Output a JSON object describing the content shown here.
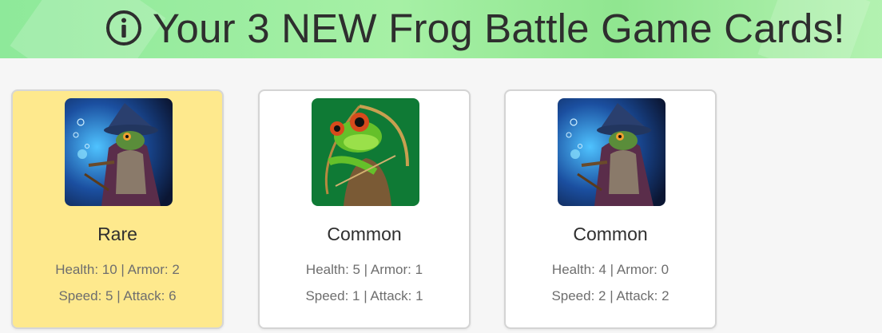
{
  "banner": {
    "title": "Your 3 NEW Frog Battle Game Cards!",
    "icon": "info-icon"
  },
  "colors": {
    "banner_bg": "#a6f0a5",
    "rare_card_bg": "#fee98d",
    "common_card_bg": "#ffffff"
  },
  "cards": [
    {
      "image": "wizard-frog-icon",
      "rarity": "Rare",
      "stats_line1": "Health: 10 | Armor: 2",
      "stats_line2": "Speed: 5 | Attack: 6"
    },
    {
      "image": "archer-frog-icon",
      "rarity": "Common",
      "stats_line1": "Health: 5 | Armor: 1",
      "stats_line2": "Speed: 1 | Attack: 1"
    },
    {
      "image": "wizard-frog-icon",
      "rarity": "Common",
      "stats_line1": "Health: 4 | Armor: 0",
      "stats_line2": "Speed: 2 | Attack: 2"
    }
  ]
}
